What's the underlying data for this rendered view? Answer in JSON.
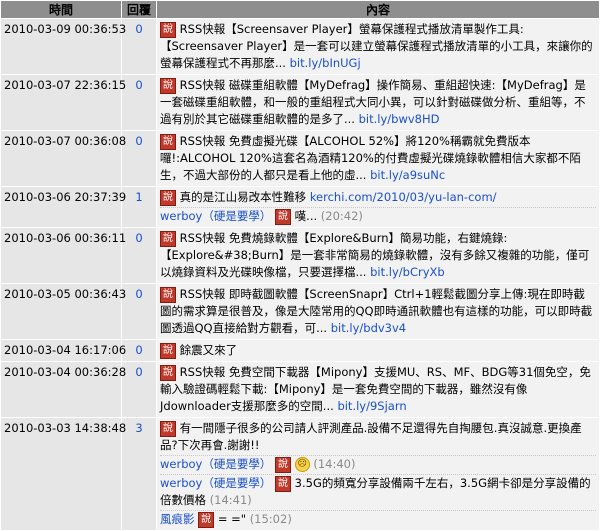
{
  "headers": {
    "time": "時間",
    "count": "回覆",
    "content": "內容"
  },
  "badge": "說",
  "rows": [
    {
      "time": "2010-03-09 00:36:53",
      "count": "0",
      "text": "RSS快報【Screensaver Player】螢幕保護程式播放清單製作工具:【Screensaver Player】是一套可以建立螢幕保護程式播放清單的小工具，來讓你的螢幕保護程式不再那麼...",
      "link": "bit.ly/bInUGj"
    },
    {
      "time": "2010-03-07 22:36:15",
      "count": "0",
      "text": "RSS快報 磁碟重組軟體【MyDefrag】操作簡易、重組超快速:【MyDefrag】是一套磁碟重組軟體，和一般的重組程式大同小異，可以針對磁碟做分析、重組等，不過有別於其它磁碟重組軟體的是多了...",
      "link": "bit.ly/bwv8HD"
    },
    {
      "time": "2010-03-07 00:36:08",
      "count": "0",
      "text": "RSS快報 免費虛擬光碟【ALCOHOL 52%】將120%稱霸就免費版本囉!:ALCOHOL 120%這套名為酒精120%的付費虛擬光碟燒錄軟體相信大家都不陌生，不過大部份的人都只是看上他的虛...",
      "link": "bit.ly/a9suNc"
    },
    {
      "time": "2010-03-06 20:37:39",
      "count": "1",
      "text": "真的是江山易改本性難移",
      "link": "kerchi.com/2010/03/yu-lan-com/",
      "reply_user": "werboy（硬是要學）",
      "reply_text": "嘆...",
      "reply_time": "(20:42)"
    },
    {
      "time": "2010-03-06 00:36:11",
      "count": "0",
      "text": "RSS快報 免費燒錄軟體【Explore&Burn】簡易功能，右鍵燒錄:【Explore&#38;Burn】是一套非常簡易的燒錄軟體，沒有多餘又複雜的功能，僅可以燒錄資料及光碟映像檔，只要選擇檔...",
      "link": "bit.ly/bCryXb"
    },
    {
      "time": "2010-03-05 00:36:43",
      "count": "0",
      "text": "RSS快報 即時截圖軟體【ScreenSnapr】Ctrl+1輕鬆截圖分享上傳:現在即時截圖的需求算是很普及，像是大陸常用的QQ即時通訊軟體也有這樣的功能，可以即時截圖透過QQ直接給對方觀看，可...",
      "link": "bit.ly/bdv3v4"
    },
    {
      "time": "2010-03-04 16:17:06",
      "count": "0",
      "text": "餘震又來了",
      "link": ""
    },
    {
      "time": "2010-03-04 00:36:28",
      "count": "0",
      "text": "RSS快報 免費空間下載器【Mipony】支援MU、RS、MF、BDG等31個免空，免輸入驗證碼輕鬆下載:【Mipony】是一套免費空間的下載器，雖然沒有像Jdownloader支援那麼多的空間...",
      "link": "bit.ly/9Sjarn"
    },
    {
      "time": "2010-03-03 14:38:48",
      "count": "3",
      "text": "有一間隱子很多的公司請人評測產品.設備不足還得先自掏腰包.真沒誠意.更換產品?下次再會.謝謝!!",
      "link": "",
      "replies": [
        {
          "user": "werboy（硬是要學）",
          "text": "",
          "time": "(14:40)",
          "face": true
        },
        {
          "user": "werboy（硬是要學）",
          "text": "3.5G的頻寬分享設備兩千左右，3.5G網卡卻是分享設備的倍數價格",
          "time": "(14:41)",
          "face": false
        },
        {
          "user": "風痕影",
          "text": "=          =\"",
          "time": "(15:02)",
          "face": false
        }
      ]
    }
  ]
}
